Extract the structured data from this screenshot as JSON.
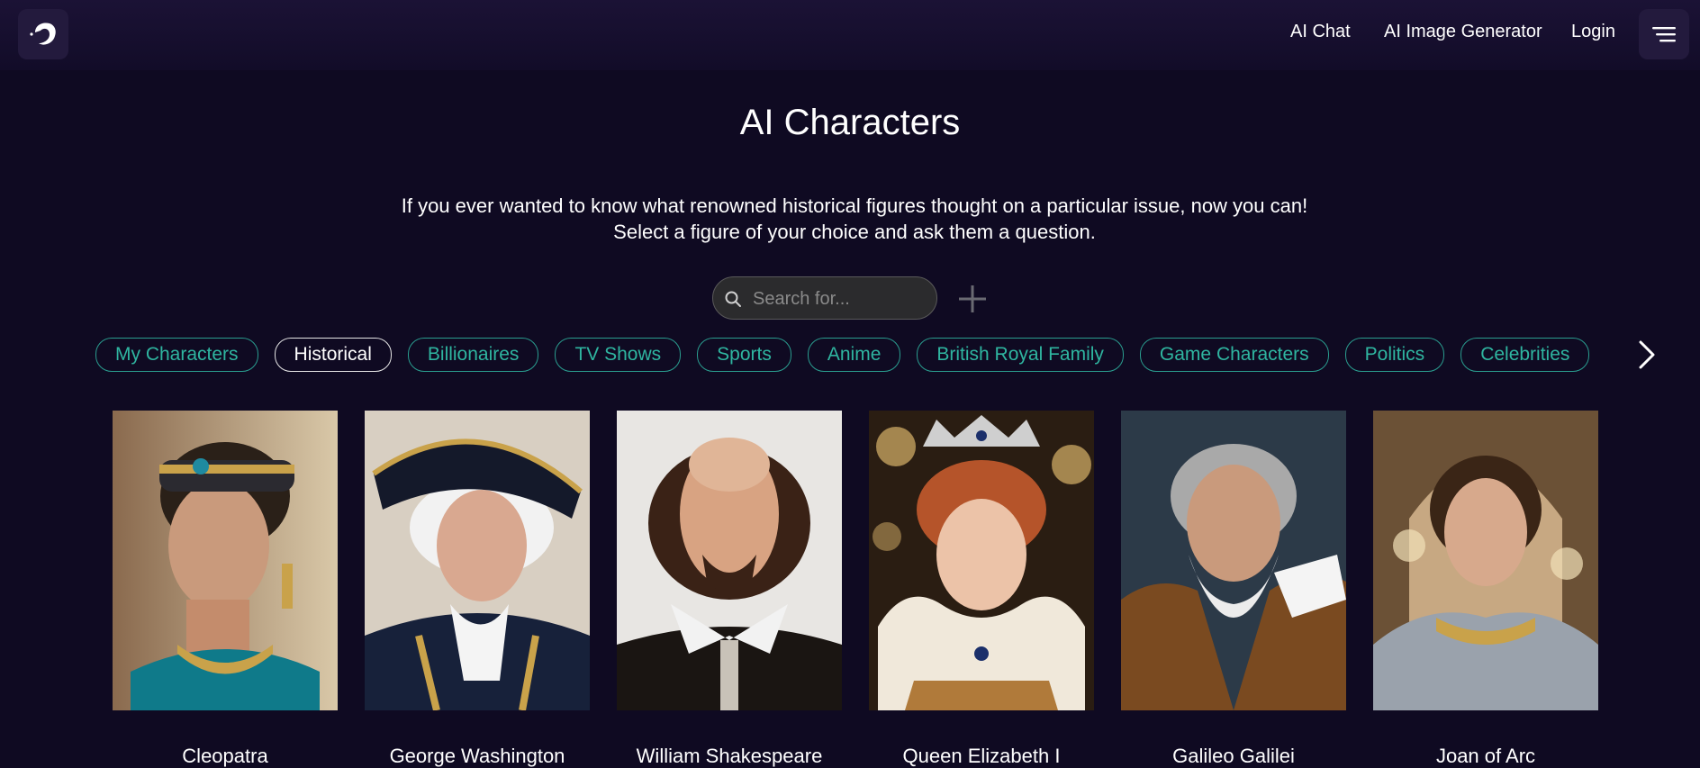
{
  "header": {
    "nav": [
      "AI Chat",
      "AI Image Generator",
      "Login"
    ]
  },
  "hero": {
    "title": "AI Characters",
    "description": "If you ever wanted to know what renowned historical figures thought on a particular issue, now you can! Select a figure of your choice and ask them a question."
  },
  "search": {
    "placeholder": "Search for..."
  },
  "categories": [
    "My Characters",
    "Historical",
    "Billionaires",
    "TV Shows",
    "Sports",
    "Anime",
    "British Royal Family",
    "Game Characters",
    "Politics",
    "Celebrities"
  ],
  "active_category": "Historical",
  "characters": [
    {
      "name": "Cleopatra"
    },
    {
      "name": "George Washington"
    },
    {
      "name": "William Shakespeare"
    },
    {
      "name": "Queen Elizabeth I"
    },
    {
      "name": "Galileo Galilei"
    },
    {
      "name": "Joan of Arc"
    }
  ],
  "colors": {
    "background": "#0f0a22",
    "accent": "#2fb5a0"
  }
}
